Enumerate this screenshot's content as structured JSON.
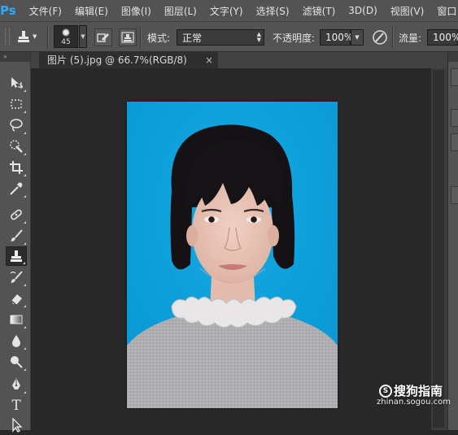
{
  "app": {
    "logo": "Ps"
  },
  "menu": [
    "文件(F)",
    "编辑(E)",
    "图像(I)",
    "图层(L)",
    "文字(Y)",
    "选择(S)",
    "滤镜(T)",
    "3D(D)",
    "视图(V)",
    "窗口"
  ],
  "options": {
    "brush_size": "45",
    "mode_label": "模式:",
    "mode_value": "正常",
    "opacity_label": "不透明度:",
    "opacity_value": "100%",
    "flow_label": "流量:",
    "flow_value": "100%"
  },
  "document": {
    "tab_title": "图片 (5).jpg @ 66.7%(RGB/8)",
    "close_glyph": "×"
  },
  "toolbox": {
    "collapse_glyph": "»",
    "tools": [
      {
        "name": "move-tool-icon",
        "active": false
      },
      {
        "name": "marquee-tool-icon",
        "active": false
      },
      {
        "name": "lasso-tool-icon",
        "active": false
      },
      {
        "name": "quick-selection-tool-icon",
        "active": false
      },
      {
        "name": "crop-tool-icon",
        "active": false
      },
      {
        "name": "eyedropper-tool-icon",
        "active": false
      },
      {
        "name": "healing-brush-tool-icon",
        "active": false
      },
      {
        "name": "brush-tool-icon",
        "active": false
      },
      {
        "name": "clone-stamp-tool-icon",
        "active": true
      },
      {
        "name": "history-brush-tool-icon",
        "active": false
      },
      {
        "name": "eraser-tool-icon",
        "active": false
      },
      {
        "name": "gradient-tool-icon",
        "active": false
      },
      {
        "name": "blur-tool-icon",
        "active": false
      },
      {
        "name": "dodge-tool-icon",
        "active": false
      },
      {
        "name": "pen-tool-icon",
        "active": false
      },
      {
        "name": "type-tool-icon",
        "active": false
      },
      {
        "name": "path-selection-tool-icon",
        "active": false
      }
    ],
    "type_glyph": "T"
  },
  "watermark": {
    "text": "搜狗指南",
    "sub": "zhinan.sogou.com"
  },
  "colors": {
    "ui_panel": "#535353",
    "canvas_bg": "#282828",
    "photo_bg": "#0ba2dc",
    "ps_blue": "#31a8ff"
  }
}
